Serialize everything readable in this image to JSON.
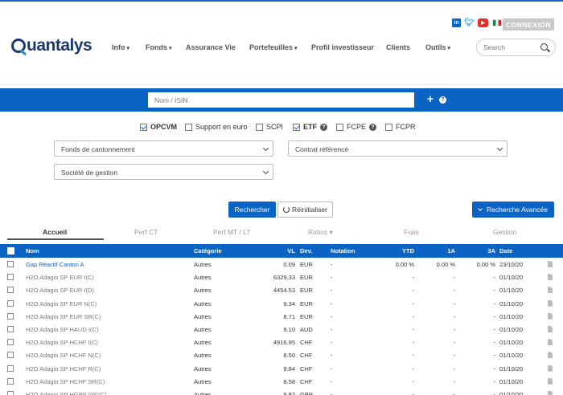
{
  "header": {
    "logo_text": "uantalys",
    "connexion_label": "CONNEXION",
    "social": [
      "linkedin-icon",
      "twitter-icon",
      "youtube-icon",
      "italy-flag-icon"
    ],
    "nav": [
      {
        "label": "Info",
        "caret": true
      },
      {
        "label": "Fonds",
        "caret": true
      },
      {
        "label": "Assurance Vie",
        "caret": false
      },
      {
        "label": "Portefeuilles",
        "caret": true
      },
      {
        "label": "Profil investisseur",
        "caret": false
      },
      {
        "label": "Clients",
        "caret": false
      },
      {
        "label": "Outils",
        "caret": true
      }
    ],
    "search_placeholder": "Search"
  },
  "searchbar": {
    "placeholder": "Nom / ISIN",
    "plus": "+",
    "help": "?"
  },
  "filters": {
    "checkboxes": [
      {
        "label": "OPCVM",
        "checked": true,
        "bold": true
      },
      {
        "label": "Support en euro",
        "checked": false,
        "bold": false
      },
      {
        "label": "SCPI",
        "checked": false,
        "bold": false
      },
      {
        "label": "ETF",
        "checked": true,
        "bold": true,
        "help": true
      },
      {
        "label": "FCPE",
        "checked": false,
        "bold": false,
        "help": true
      },
      {
        "label": "FCPR",
        "checked": false,
        "bold": false
      }
    ],
    "select_fonds": "Fonds de cantonnement",
    "select_contrat": "Contrat référencé",
    "select_societe": "Société de gestion",
    "search_button": "Rechercher",
    "reset_button": "Réinitialiser",
    "advanced_button": "Recherche Avancée"
  },
  "tabs": [
    "Accueil",
    "Perf CT",
    "Perf MT / LT",
    "Ratios",
    "Frais",
    "Gestion"
  ],
  "table": {
    "headers": {
      "nom": "Nom",
      "categorie": "Catégorie",
      "vl": "VL",
      "dev": "Dev.",
      "notation": "Notation",
      "ytd": "YTD",
      "a1": "1A",
      "a3": "3A",
      "date": "Date"
    },
    "rows": [
      {
        "nom": "Gap Réactif Canton A",
        "categorie": "Autres",
        "vl": "0.09",
        "dev": "EUR",
        "notation": "-",
        "ytd": "0.00 %",
        "a1": "0.00 %",
        "a3": "0.00 %",
        "date": "23/10/20",
        "link": true
      },
      {
        "nom": "H2O Adagio SP EUR I(C)",
        "categorie": "Autres",
        "vl": "6329.33",
        "dev": "EUR",
        "notation": "-",
        "ytd": "-",
        "a1": "-",
        "a3": "-",
        "date": "01/10/20"
      },
      {
        "nom": "H2O Adagio SP EUR I(D)",
        "categorie": "Autres",
        "vl": "4454.53",
        "dev": "EUR",
        "notation": "-",
        "ytd": "-",
        "a1": "-",
        "a3": "-",
        "date": "01/10/20"
      },
      {
        "nom": "H2O Adagio SP EUR N(C)",
        "categorie": "Autres",
        "vl": "9.34",
        "dev": "EUR",
        "notation": "-",
        "ytd": "-",
        "a1": "-",
        "a3": "-",
        "date": "01/10/20"
      },
      {
        "nom": "H2O Adagio SP EUR SR(C)",
        "categorie": "Autres",
        "vl": "8.71",
        "dev": "EUR",
        "notation": "-",
        "ytd": "-",
        "a1": "-",
        "a3": "-",
        "date": "01/10/20"
      },
      {
        "nom": "H2O Adagio SP HAUD I(C)",
        "categorie": "Autres",
        "vl": "9.10",
        "dev": "AUD",
        "notation": "-",
        "ytd": "-",
        "a1": "-",
        "a3": "-",
        "date": "01/10/20"
      },
      {
        "nom": "H2O Adagio SP HCHF I(C)",
        "categorie": "Autres",
        "vl": "4916.95",
        "dev": "CHF",
        "notation": "-",
        "ytd": "-",
        "a1": "-",
        "a3": "-",
        "date": "01/10/20"
      },
      {
        "nom": "H2O Adagio SP HCHF N(C)",
        "categorie": "Autres",
        "vl": "8.50",
        "dev": "CHF",
        "notation": "-",
        "ytd": "-",
        "a1": "-",
        "a3": "-",
        "date": "01/10/20"
      },
      {
        "nom": "H2O Adagio SP HCHF R(C)",
        "categorie": "Autres",
        "vl": "9.84",
        "dev": "CHF",
        "notation": "-",
        "ytd": "-",
        "a1": "-",
        "a3": "-",
        "date": "01/10/20"
      },
      {
        "nom": "H2O Adagio SP HCHF SR(C)",
        "categorie": "Autres",
        "vl": "8.58",
        "dev": "CHF",
        "notation": "-",
        "ytd": "-",
        "a1": "-",
        "a3": "-",
        "date": "01/10/20"
      },
      {
        "nom": "H2O Adagio SP HGBP I(R)(C)",
        "categorie": "Autres",
        "vl": "9.82",
        "dev": "GBP",
        "notation": "-",
        "ytd": "-",
        "a1": "-",
        "a3": "-",
        "date": "01/10/20"
      }
    ]
  },
  "colors": {
    "primary": "#0b63c4",
    "logo": "#1c3a6e",
    "link": "#1a5fb4"
  }
}
